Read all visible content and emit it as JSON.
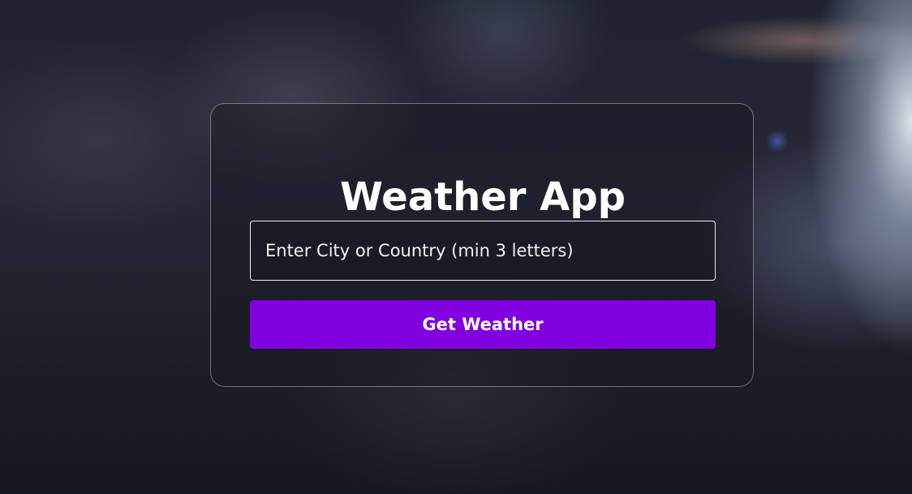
{
  "app": {
    "title": "Weather App"
  },
  "search": {
    "placeholder": "Enter City or Country (min 3 letters)",
    "value": ""
  },
  "actions": {
    "submit_label": "Get Weather"
  },
  "colors": {
    "button_background": "#8000e0",
    "text": "#ffffff"
  }
}
